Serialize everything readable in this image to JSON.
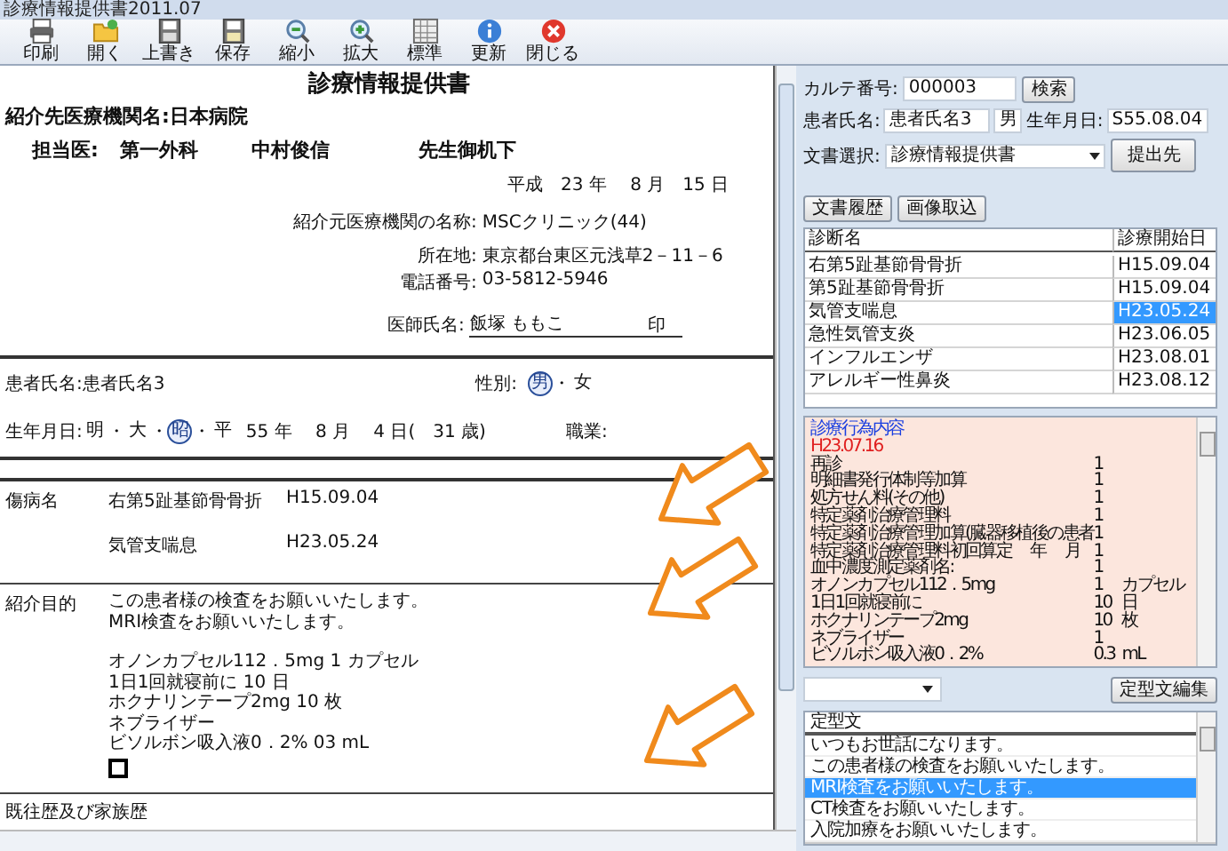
{
  "window": {
    "title": "診療情報提供書2011.07"
  },
  "toolbar": [
    {
      "label": "印刷",
      "kind": "print"
    },
    {
      "label": "開く",
      "kind": "open"
    },
    {
      "label": "上書き",
      "kind": "overwrite"
    },
    {
      "label": "保存",
      "kind": "save"
    },
    {
      "label": "縮小",
      "kind": "shrink"
    },
    {
      "label": "拡大",
      "kind": "enlarge"
    },
    {
      "label": "標準",
      "kind": "standard"
    },
    {
      "label": "更新",
      "kind": "update"
    },
    {
      "label": "閉じる",
      "kind": "close"
    }
  ],
  "document": {
    "title": "診療情報提供書",
    "recipient_label": "紹介先医療機関名:",
    "recipient": "日本病院",
    "doctor_label": "担当医:",
    "department": "第一外科",
    "doctor": "中村俊信",
    "salutation": "先生御机下",
    "date": "平成　23 年　 8 月　15 日",
    "sender": [
      {
        "label": "紹介元医療機関の名称:",
        "value": "MSCクリニック(44)"
      },
      {
        "label": "所在地:",
        "value": "東京都台東区元浅草2－11－6"
      },
      {
        "label": "電話番号:",
        "value": "03-5812-5946"
      }
    ],
    "physician_label": "医師氏名:",
    "physician": "飯塚 ももこ",
    "seal": "印",
    "patient_label": "患者氏名:",
    "patient": "患者氏名3",
    "sex_label": "性別:",
    "separator": "・",
    "sex_options": [
      {
        "label": "男",
        "selected": true
      },
      {
        "label": "女",
        "selected": false
      }
    ],
    "birth_label": "生年月日:",
    "eras": [
      {
        "label": "明",
        "selected": false
      },
      {
        "label": "大",
        "selected": false
      },
      {
        "label": "昭",
        "selected": true
      },
      {
        "label": "平",
        "selected": false
      }
    ],
    "birth_date": "55 年　 8 月　 4 日(　31 歳)",
    "occupation_label": "職業:",
    "diagnoses_label": "傷病名",
    "diagnoses": [
      {
        "name": "右第5趾基節骨骨折",
        "date": "H15.09.04"
      },
      {
        "name": "気管支喘息",
        "date": "H23.05.24"
      }
    ],
    "purpose_label": "紹介目的",
    "purpose_paragraphs": [
      [
        "この患者様の検査をお願いいたします。",
        "MRI検査をお願いいたします。"
      ],
      [
        "オノンカプセル112．5mg 1 カプセル",
        "1日1回就寝前に 10 日",
        "ホクナリンテープ2mg 10 枚",
        "ネブライザー",
        "ビソルボン吸入液0．2% 03 mL"
      ]
    ],
    "history_label": "既往歴及び家族歴"
  },
  "side": {
    "chart_label": "カルテ番号:",
    "chart_number": "000003",
    "search_button": "検索",
    "patient_label": "患者氏名:",
    "patient": "患者氏名3",
    "sex": "男",
    "birth_label": "生年月日:",
    "birth": "S55.08.04",
    "doc_label": "文書選択:",
    "doc_value": "診療情報提供書",
    "submit_button": "提出先",
    "buttons": [
      "文書履歴",
      "画像取込"
    ],
    "diagnosis_table": {
      "columns": [
        "診断名",
        "診療開始日"
      ],
      "rows": [
        {
          "name": "右第5趾基節骨骨折",
          "date": "H15.09.04",
          "selected": false
        },
        {
          "name": "第5趾基節骨骨折",
          "date": "H15.09.04",
          "selected": false
        },
        {
          "name": "気管支喘息",
          "date": "H23.05.24",
          "selected": true
        },
        {
          "name": "急性気管支炎",
          "date": "H23.06.05",
          "selected": false
        },
        {
          "name": "インフルエンザ",
          "date": "H23.08.01",
          "selected": false
        },
        {
          "name": "アレルギー性鼻炎",
          "date": "H23.08.12",
          "selected": false
        }
      ]
    },
    "treatment": {
      "title": "診療行為内容",
      "date": "H23.07.16",
      "rows": [
        {
          "name": "再診",
          "qty": "1"
        },
        {
          "name": "明細書発行体制等加算",
          "qty": "1"
        },
        {
          "name": "処方せん料(その他)",
          "qty": "1"
        },
        {
          "name": "特定薬剤治療管理料",
          "qty": "1"
        },
        {
          "name": "特定薬剤治療管理加算(臓器移植後の患者",
          "qty": "1"
        },
        {
          "name": "特定薬剤治療管理料初回算定　 年　 月",
          "qty": "1"
        },
        {
          "name": "血中濃度測定薬剤名:",
          "qty": "1"
        },
        {
          "name": "オノンカプセル112．5mg",
          "qty": "1",
          "unit": "カプセル"
        },
        {
          "name": "1日1回就寝前に",
          "qty": "10",
          "unit": "日"
        },
        {
          "name": "ホクナリンテープ2mg",
          "qty": "10",
          "unit": "枚"
        },
        {
          "name": "ネブライザー",
          "qty": "1"
        },
        {
          "name": "ビソルボン吸入液0．2%",
          "qty": "0.3",
          "unit": "mL"
        }
      ]
    },
    "edit_button": "定型文編集",
    "phrases": {
      "column": "定型文",
      "rows": [
        {
          "text": "いつもお世話になります。",
          "selected": false
        },
        {
          "text": "この患者様の検査をお願いいたします。",
          "selected": false
        },
        {
          "text": "MRI検査をお願いいたします。",
          "selected": true
        },
        {
          "text": "CT検査をお願いいたします。",
          "selected": false
        },
        {
          "text": "入院加療をお願いいたします。",
          "selected": false
        }
      ]
    }
  },
  "annotations": [
    {
      "kind": "arrow"
    },
    {
      "kind": "arrow"
    },
    {
      "kind": "arrow"
    }
  ]
}
